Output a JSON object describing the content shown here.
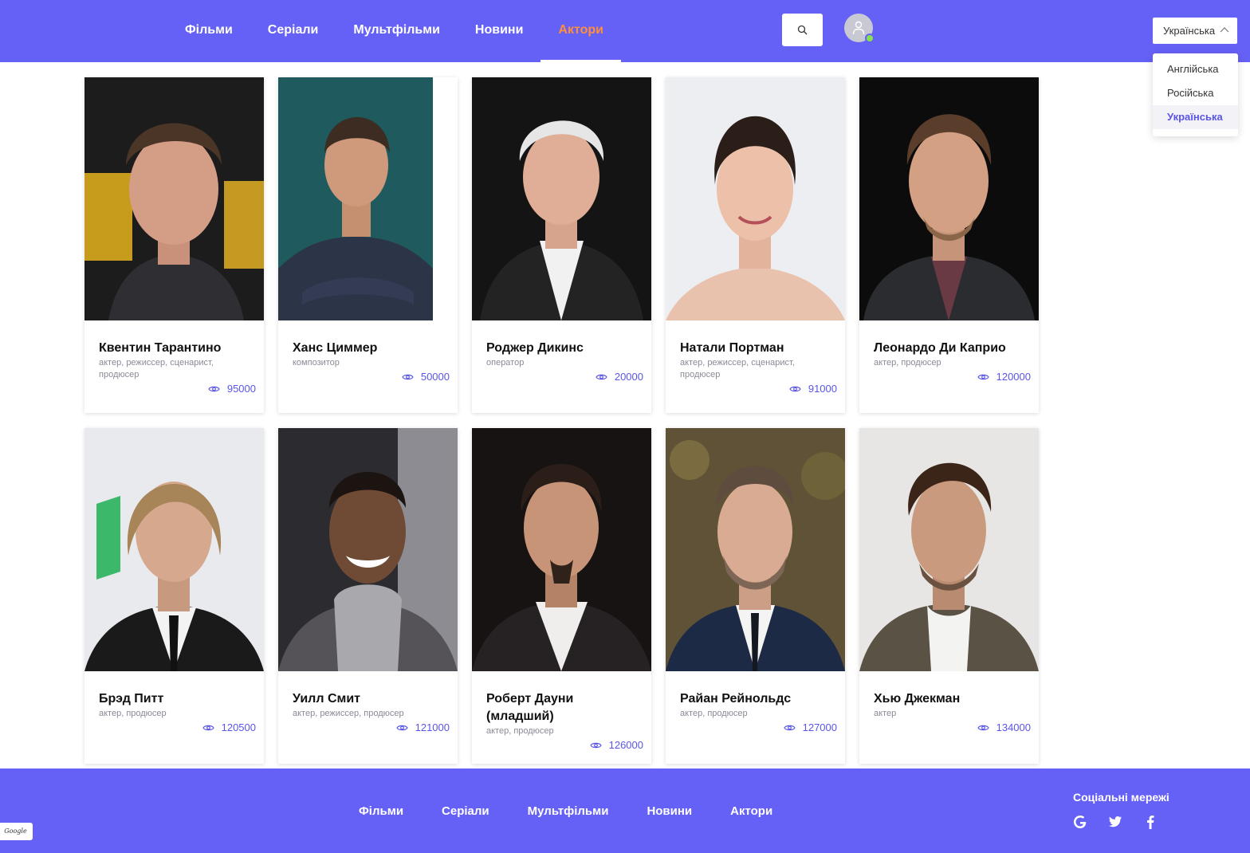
{
  "header": {
    "nav": [
      {
        "label": "Фільми",
        "active": false
      },
      {
        "label": "Серіали",
        "active": false
      },
      {
        "label": "Мультфільми",
        "active": false
      },
      {
        "label": "Новини",
        "active": false
      },
      {
        "label": "Актори",
        "active": true
      }
    ],
    "search_icon": "search-icon",
    "avatar_icon": "user-icon",
    "language": {
      "selected": "Українська",
      "options": [
        "Англійська",
        "Російська",
        "Українська"
      ]
    }
  },
  "actors": [
    {
      "name": "Квентин Тарантино",
      "roles": "актер, режиссер, сценарист, продюсер",
      "views": "95000"
    },
    {
      "name": "Ханс Циммер",
      "roles": "композитор",
      "views": "50000"
    },
    {
      "name": "Роджер Дикинс",
      "roles": "оператор",
      "views": "20000"
    },
    {
      "name": "Натали Портман",
      "roles": "актер, режиссер, сценарист, продюсер",
      "views": "91000"
    },
    {
      "name": "Леонардо Ди Каприо",
      "roles": "актер, продюсер",
      "views": "120000"
    },
    {
      "name": "Брэд Питт",
      "roles": "актер, продюсер",
      "views": "120500"
    },
    {
      "name": "Уилл Смит",
      "roles": "актер, режиссер, продюсер",
      "views": "121000"
    },
    {
      "name": "Роберт Дауни (младший)",
      "roles": "актер, продюсер",
      "views": "126000"
    },
    {
      "name": "Райан Рейнольдс",
      "roles": "актер, продюсер",
      "views": "127000"
    },
    {
      "name": "Хью Джекман",
      "roles": "актер",
      "views": "134000"
    }
  ],
  "footer": {
    "nav": [
      "Фільми",
      "Серіали",
      "Мультфільми",
      "Новини",
      "Актори"
    ],
    "social_title": "Соціальні мережі",
    "social": [
      "google-icon",
      "twitter-icon",
      "facebook-icon"
    ],
    "store_badge": "Google play"
  },
  "colors": {
    "brand": "#6661f6",
    "active_nav": "#ff8e3c",
    "views": "#5a55e8",
    "online": "#86e34d"
  }
}
